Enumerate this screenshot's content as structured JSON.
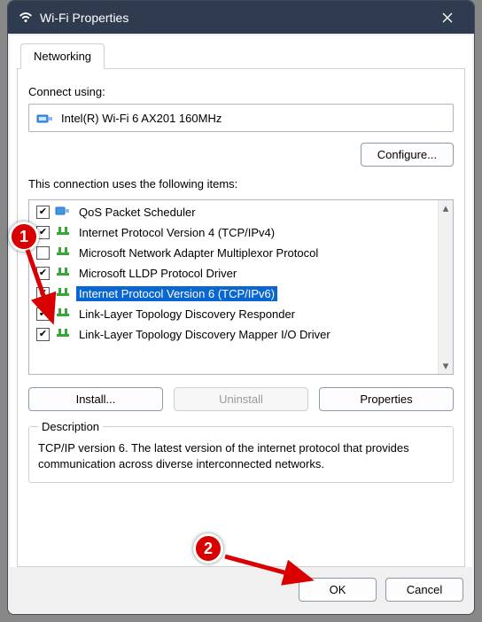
{
  "titlebar": {
    "title": "Wi-Fi Properties"
  },
  "tabs": {
    "networking": "Networking"
  },
  "connect_using_label": "Connect using:",
  "adapter_name": "Intel(R) Wi-Fi 6 AX201 160MHz",
  "configure_btn": "Configure...",
  "items_label": "This connection uses the following items:",
  "items": [
    {
      "checked": true,
      "selected": false,
      "icon": "sched",
      "label": "QoS Packet Scheduler"
    },
    {
      "checked": true,
      "selected": false,
      "icon": "proto",
      "label": "Internet Protocol Version 4 (TCP/IPv4)"
    },
    {
      "checked": false,
      "selected": false,
      "icon": "proto",
      "label": "Microsoft Network Adapter Multiplexor Protocol"
    },
    {
      "checked": true,
      "selected": false,
      "icon": "proto",
      "label": "Microsoft LLDP Protocol Driver"
    },
    {
      "checked": true,
      "selected": true,
      "icon": "proto",
      "label": "Internet Protocol Version 6 (TCP/IPv6)"
    },
    {
      "checked": true,
      "selected": false,
      "icon": "proto",
      "label": "Link-Layer Topology Discovery Responder"
    },
    {
      "checked": true,
      "selected": false,
      "icon": "proto",
      "label": "Link-Layer Topology Discovery Mapper I/O Driver"
    }
  ],
  "buttons": {
    "install": "Install...",
    "uninstall": "Uninstall",
    "properties": "Properties",
    "ok": "OK",
    "cancel": "Cancel"
  },
  "description": {
    "legend": "Description",
    "text": "TCP/IP version 6. The latest version of the internet protocol that provides communication across diverse interconnected networks."
  },
  "annotations": {
    "badge1": "1",
    "badge2": "2"
  }
}
